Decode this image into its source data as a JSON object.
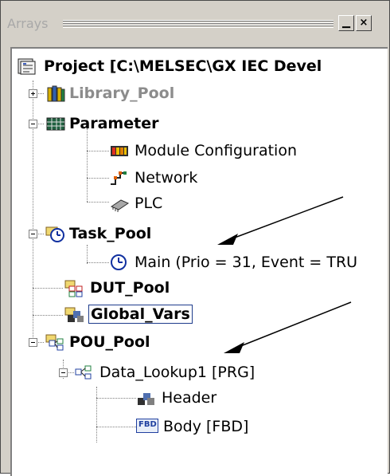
{
  "window": {
    "title": "Arrays",
    "minimize_glyph": "▁",
    "close_glyph": "×"
  },
  "tree": {
    "project": {
      "label": "Project [C:\\MELSEC\\GX IEC Devel",
      "icon": "project-icon"
    },
    "library_pool": {
      "label": "Library_Pool",
      "icon": "library-books-icon",
      "color": "#8c8c8c"
    },
    "parameter": {
      "label": "Parameter",
      "icon": "parameter-grid-icon"
    },
    "module_configuration": {
      "label": "Module Configuration",
      "icon": "module-config-icon"
    },
    "network": {
      "label": "Network",
      "icon": "network-icon"
    },
    "plc": {
      "label": "PLC",
      "icon": "plc-chip-icon"
    },
    "task_pool": {
      "label": "Task_Pool",
      "icon": "task-clock-folder-icon"
    },
    "main_task": {
      "label": "Main (Prio = 31, Event = TRU",
      "icon": "clock-icon"
    },
    "dut_pool": {
      "label": "DUT_Pool",
      "icon": "dut-folder-icon"
    },
    "global_vars": {
      "label": "Global_Vars",
      "icon": "global-vars-icon"
    },
    "pou_pool": {
      "label": "POU_Pool",
      "icon": "pou-folder-icon"
    },
    "data_lookup": {
      "label": "Data_Lookup1 [PRG]",
      "icon": "pou-icon"
    },
    "header": {
      "label": "Header",
      "icon": "header-blocks-icon"
    },
    "body": {
      "label": "Body [FBD]",
      "icon": "fbd-icon",
      "badge": "FBD"
    }
  },
  "colors": {
    "selection_border": "#1e3c8c",
    "dimmed_text": "#8c8c8c"
  }
}
